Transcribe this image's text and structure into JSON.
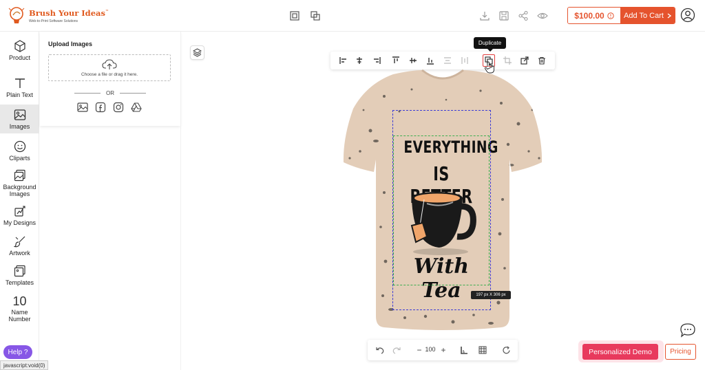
{
  "header": {
    "logo_title": "Brush Your Ideas",
    "logo_tm": "™",
    "logo_subtitle": "Web-to-Print Software Solutions",
    "center_icons": [
      "copy-icon",
      "duplicate-frame-icon"
    ],
    "right_icons": [
      "download-icon",
      "save-icon",
      "share-icon",
      "preview-eye-icon"
    ],
    "price": "$100.00",
    "add_to_cart": "Add To Cart",
    "accent_color": "#e5532d"
  },
  "sidebar": {
    "items": [
      {
        "label": "Product",
        "icon": "cube-icon"
      },
      {
        "label": "Plain Text",
        "icon": "text-t-icon"
      },
      {
        "label": "Images",
        "icon": "image-icon",
        "active": true
      },
      {
        "label": "Cliparts",
        "icon": "smiley-icon"
      },
      {
        "label": "Background Images",
        "icon": "layers-image-icon"
      },
      {
        "label": "My Designs",
        "icon": "designs-icon"
      },
      {
        "label": "Artwork",
        "icon": "brush-icon"
      },
      {
        "label": "Templates",
        "icon": "template-icon"
      },
      {
        "label": "Name Number",
        "number": "10"
      }
    ]
  },
  "upload_panel": {
    "title": "Upload Images",
    "drop_text": "Choose a file or drag it here.",
    "or_text": "OR",
    "sources": [
      "gallery-icon",
      "facebook-icon",
      "instagram-icon",
      "google-drive-icon"
    ]
  },
  "toolbar": {
    "icons": [
      "align-left-icon",
      "align-center-icon",
      "align-right-icon",
      "align-top-icon",
      "align-middle-icon",
      "align-bottom-icon",
      "distribute-horizontal-icon",
      "distribute-vertical-icon",
      "duplicate-icon",
      "crop-icon",
      "flip-icon",
      "delete-icon"
    ],
    "tooltip": "Duplicate"
  },
  "canvas": {
    "artwork_line1": "EVERYTHING",
    "artwork_line2": "IS BETTER",
    "artwork_line3": "With Tea",
    "dimension_label": "197 px X 306 px",
    "shirt_color": "#e3cdb8"
  },
  "bottom_bar": {
    "zoom_minus": "−",
    "zoom_value": "100",
    "zoom_plus": "+"
  },
  "footer": {
    "personalized_demo": "Personalized Demo",
    "pricing": "Pricing",
    "help": "Help ?",
    "status_text": "javascript:void(0)"
  }
}
